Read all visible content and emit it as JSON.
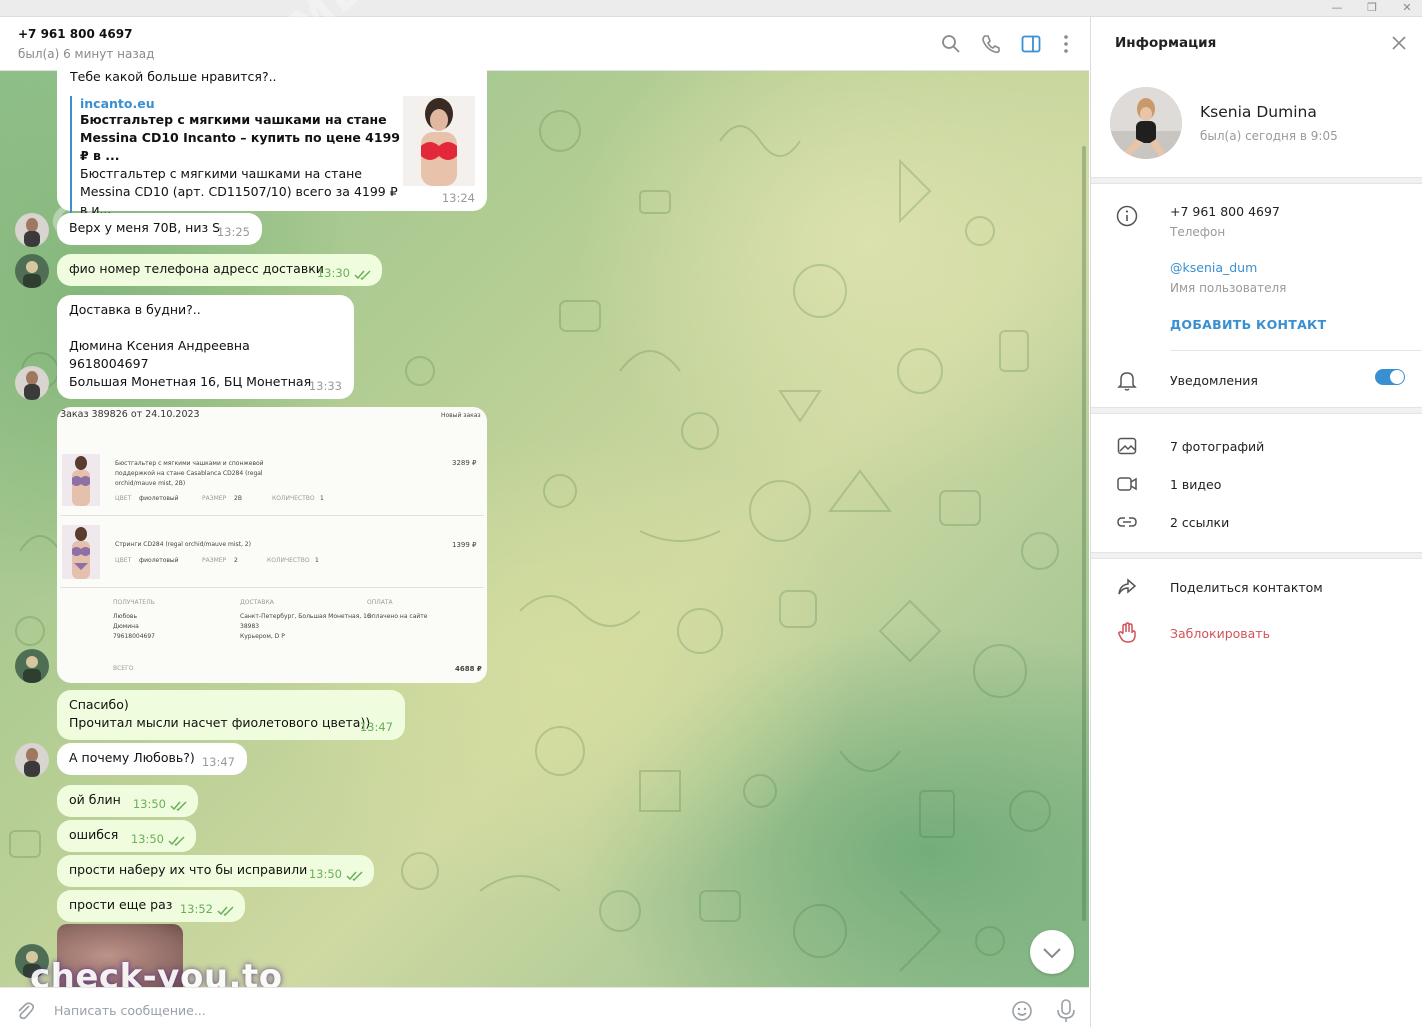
{
  "window": {
    "minimize": "—",
    "restore": "❐",
    "close": "✕"
  },
  "chat_header": {
    "title": "+7 961 800 4697",
    "status": "был(а) 6 минут назад",
    "icons": [
      "search-icon",
      "phone-icon",
      "sidebar-toggle-icon",
      "more-icon"
    ]
  },
  "messages": {
    "m1": {
      "text": "Тебе какой больше нравится?..",
      "site": "incanto.eu",
      "title": "Бюстгальтер с мягкими чашками на стане Messina CD10 Incanto – купить по цене 4199 ₽ в ...",
      "desc": "Бюстгальтер с мягкими чашками на стане Messina CD10 (арт. CD11507/10) всего за 4199 ₽ в и...",
      "time": "13:24"
    },
    "m2": {
      "text": "Верх у меня 70В, низ S",
      "time": "13:25"
    },
    "m3": {
      "text": "фио номер телефона адресс доставки",
      "time": "13:30"
    },
    "m4": {
      "line1": "Доставка в будни?..",
      "line2": "Дюмина Ксения Андреевна",
      "line3": "9618004697",
      "line4": "Большая Монетная 16, БЦ Монетная",
      "time": "13:33"
    },
    "order": {
      "header": "Заказ 389826 от 24.10.2023",
      "status": "Новый заказ",
      "item1_name": "Бюстгальтер с мягкими чашками и спонжевой поддержкой на стане Casablanca CD284 (regal orchid/mauve mist, 2B)",
      "item1_color_label": "ЦВЕТ",
      "item1_color": "фиолетовый",
      "item1_size_label": "РАЗМЕР",
      "item1_size": "2B",
      "item1_qty_label": "КОЛИЧЕСТВО",
      "item1_qty": "1",
      "item1_price": "3289 ₽",
      "item2_name": "Стринги CD284 (regal orchid/mauve mist, 2)",
      "item2_color_label": "ЦВЕТ",
      "item2_color": "фиолетовый",
      "item2_size_label": "РАЗМЕР",
      "item2_size": "2",
      "item2_qty_label": "КОЛИЧЕСТВО",
      "item2_qty": "1",
      "item2_price": "1399 ₽",
      "recipient_label": "ПОЛУЧАТЕЛЬ",
      "recipient1": "Любовь",
      "recipient2": "Дюмина",
      "recipient3": "79618004697",
      "delivery_label": "ДОСТАВКА",
      "delivery1": "Санкт-Петербург, Большая Монетная, 16",
      "delivery2": "38983",
      "delivery3": "Курьером, D P",
      "payment_label": "ОПЛАТА",
      "payment": "Оплачено на сайте",
      "total_label": "ВСЕГО",
      "total": "4688 ₽"
    },
    "m5": {
      "line1": "Спасибо)",
      "line2": "Прочитал мысли насчет фиолетового цвета))",
      "time": "13:47"
    },
    "m6": {
      "text": "А почему Любовь?)",
      "time": "13:47"
    },
    "m7": {
      "text": "ой блин",
      "time": "13:50"
    },
    "m8": {
      "text": "ошибся",
      "time": "13:50"
    },
    "m9": {
      "text": "прости наберу их что бы исправили",
      "time": "13:50"
    },
    "m10": {
      "text": "прости еще раз",
      "time": "13:52"
    }
  },
  "watermarks": {
    "bottom": "check-you.to",
    "diagonal": "CHECK-YOU.ME"
  },
  "composer": {
    "placeholder": "Написать сообщение...",
    "icons": [
      "attach-icon",
      "emoji-icon",
      "microphone-icon"
    ]
  },
  "info_panel": {
    "title": "Информация",
    "name": "Ksenia Dumina",
    "status": "был(а) сегодня в 9:05",
    "phone": "+7 961 800 4697",
    "phone_label": "Телефон",
    "username": "@ksenia_dum",
    "username_label": "Имя пользователя",
    "add_contact": "ДОБАВИТЬ КОНТАКТ",
    "notifications": "Уведомления",
    "notifications_on": true,
    "photos": "7 фотографий",
    "videos": "1 видео",
    "links": "2 ссылки",
    "share": "Поделиться контактом",
    "block": "Заблокировать"
  },
  "colors": {
    "accent": "#3a8fd1",
    "outgoing_bubble": "#effdde",
    "danger": "#d0535a",
    "check": "#6cae5c"
  }
}
